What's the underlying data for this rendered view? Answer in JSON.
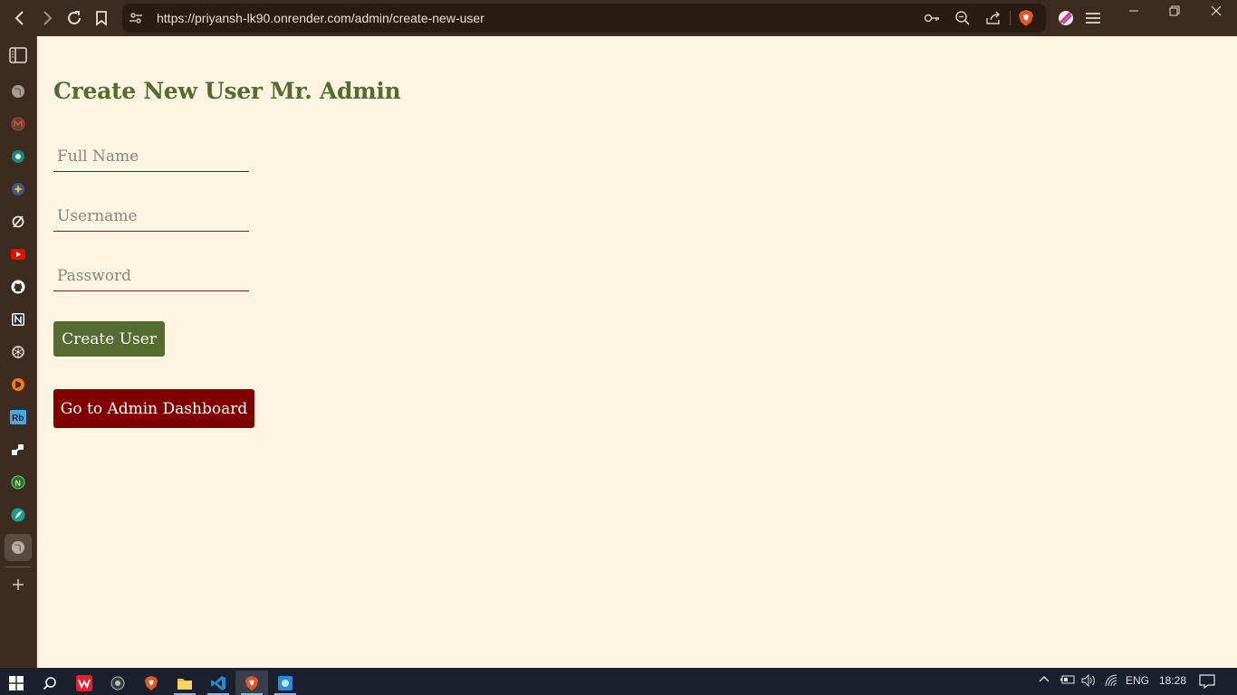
{
  "browser": {
    "url": "https://priyansh-lk90.onrender.com/admin/create-new-user",
    "icons": {
      "back": "back-arrow-icon",
      "forward": "forward-arrow-icon",
      "reload": "reload-icon",
      "bookmark": "bookmark-icon",
      "site_settings": "site-settings-icon",
      "key": "key-icon",
      "zoom": "zoom-icon",
      "share": "share-icon",
      "brave": "brave-shield-icon",
      "wallet": "brave-wallet-icon",
      "menu": "hamburger-menu-icon"
    },
    "window_controls": [
      "minimize",
      "restore",
      "close"
    ]
  },
  "sidebar": {
    "items": [
      "sidebar-toggle-icon",
      "globe-icon",
      "gmail-icon",
      "chatgpt-green-icon",
      "gemini-icon",
      "link-icon",
      "youtube-icon",
      "github-icon",
      "notion-icon",
      "openai-icon",
      "hashnode-icon",
      "rb-icon",
      "dev-icon",
      "n-icon",
      "feather-icon",
      "globe-active-icon"
    ],
    "add_icon": "plus-icon"
  },
  "page": {
    "title": "Create New User Mr. Admin",
    "fields": {
      "full_name_placeholder": "Full Name",
      "username_placeholder": "Username",
      "password_placeholder": "Password"
    },
    "create_button": "Create User",
    "dashboard_button": "Go to Admin Dashboard"
  },
  "colors": {
    "background": "#fdf5e2",
    "title": "#556b2f",
    "create_button": "#556b2f",
    "dashboard_button": "#800000",
    "field_underline": "#7a1a1a",
    "browser_chrome": "#3d2b1f"
  },
  "taskbar": {
    "apps": [
      "windows-start-icon",
      "search-icon",
      "wps-icon",
      "obs-icon",
      "brave-icon",
      "file-explorer-icon",
      "vscode-icon",
      "brave-active-icon",
      "app-icon"
    ],
    "tray": {
      "language": "ENG",
      "time": "18:28"
    }
  }
}
